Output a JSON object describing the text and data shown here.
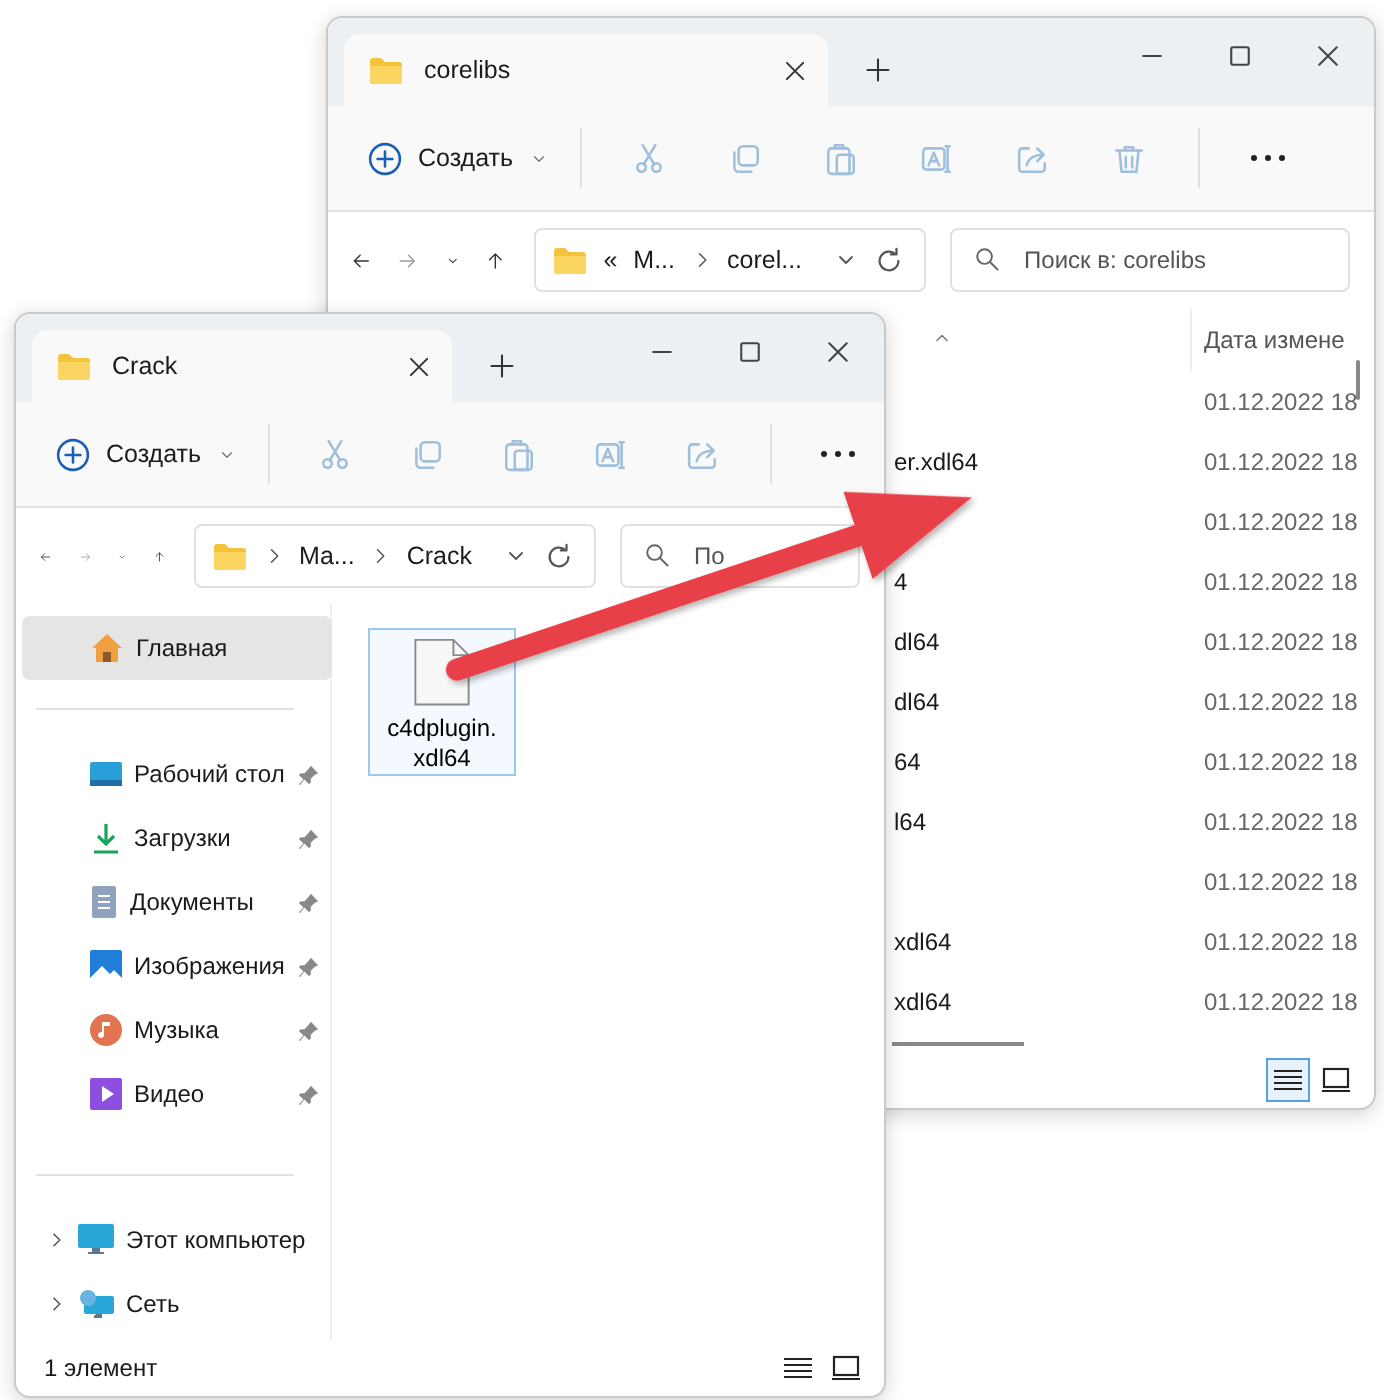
{
  "back_window": {
    "tab": {
      "title": "corelibs"
    },
    "toolbar": {
      "create_label": "Создать",
      "tools": [
        {
          "kind": "cut",
          "disabled": true
        },
        {
          "kind": "copy",
          "disabled": true
        },
        {
          "kind": "paste",
          "disabled": true
        },
        {
          "kind": "rename",
          "disabled": true
        },
        {
          "kind": "share",
          "disabled": true
        },
        {
          "kind": "delete",
          "disabled": true
        },
        {
          "kind": "more",
          "disabled": false
        }
      ]
    },
    "address": {
      "overflow_mark": "«",
      "crumbs": [
        "M...",
        "corel..."
      ]
    },
    "search": {
      "placeholder": "Поиск в: corelibs"
    },
    "table": {
      "columns": [
        "Дата измене"
      ],
      "rows": [
        {
          "date": "01.12.2022 18"
        },
        {
          "name": "er.xdl64",
          "date": "01.12.2022 18"
        },
        {
          "date": "01.12.2022 18"
        },
        {
          "name": "4",
          "date": "01.12.2022 18"
        },
        {
          "name": "dl64",
          "date": "01.12.2022 18"
        },
        {
          "name": "dl64",
          "date": "01.12.2022 18"
        },
        {
          "name": "64",
          "date": "01.12.2022 18"
        },
        {
          "name": "l64",
          "date": "01.12.2022 18"
        },
        {
          "date": "01.12.2022 18"
        },
        {
          "name": "xdl64",
          "date": "01.12.2022 18"
        },
        {
          "name": "xdl64",
          "date": "01.12.2022 18"
        }
      ]
    },
    "views": [
      {
        "kind": "details",
        "selected": true
      },
      {
        "kind": "tiles",
        "selected": false
      }
    ]
  },
  "front_window": {
    "tab": {
      "title": "Crack"
    },
    "toolbar": {
      "create_label": "Создать",
      "tools": [
        {
          "kind": "cut",
          "disabled": true
        },
        {
          "kind": "copy",
          "disabled": true
        },
        {
          "kind": "paste",
          "disabled": true
        },
        {
          "kind": "rename",
          "disabled": true
        },
        {
          "kind": "share",
          "disabled": true
        },
        {
          "kind": "more",
          "disabled": false
        }
      ]
    },
    "address": {
      "crumbs": [
        "Ma...",
        "Crack"
      ]
    },
    "search": {
      "placeholder": "По"
    },
    "sidebar": {
      "sections": [
        {
          "items": [
            {
              "kind": "home",
              "label": "Главная",
              "selected": true
            }
          ]
        },
        {
          "items": [
            {
              "kind": "desktop",
              "label": "Рабочий стол",
              "selected": false,
              "pinned": true
            },
            {
              "kind": "downloads",
              "label": "Загрузки",
              "selected": false,
              "pinned": true
            },
            {
              "kind": "documents",
              "label": "Документы",
              "selected": false,
              "pinned": true
            },
            {
              "kind": "pictures",
              "label": "Изображения",
              "selected": false,
              "pinned": true
            },
            {
              "kind": "music",
              "label": "Музыка",
              "selected": false,
              "pinned": true
            },
            {
              "kind": "videos",
              "label": "Видео",
              "selected": false,
              "pinned": true
            }
          ]
        },
        {
          "items": [
            {
              "kind": "computer",
              "label": "Этот компьютер",
              "selected": false,
              "expanded": false
            },
            {
              "kind": "network",
              "label": "Сеть",
              "selected": false,
              "expanded": false
            }
          ]
        }
      ]
    },
    "files": [
      {
        "name": "c4dplugin.\nxdl64",
        "selected": true
      }
    ],
    "status_bar": {
      "count": "1 элемент"
    },
    "views": [
      {
        "kind": "details",
        "selected": false
      },
      {
        "kind": "tiles",
        "selected": false
      }
    ]
  }
}
